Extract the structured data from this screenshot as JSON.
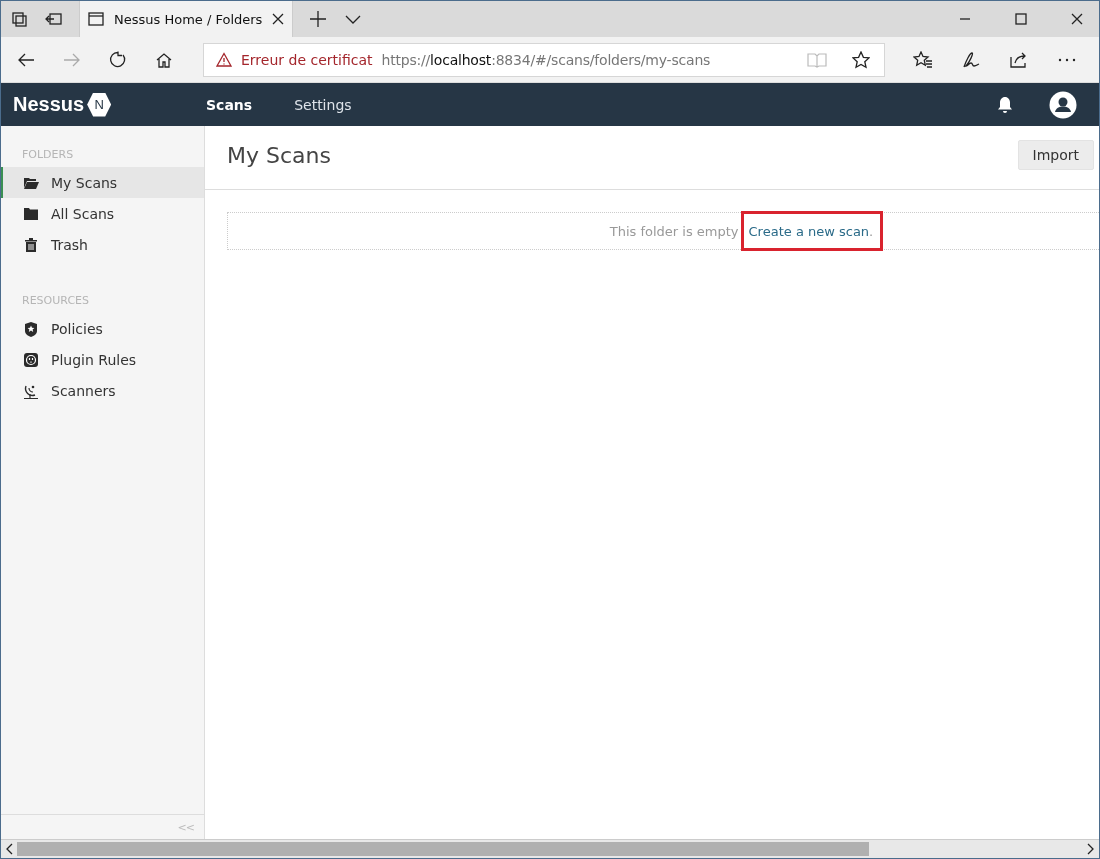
{
  "browser": {
    "tab": {
      "title": "Nessus Home / Folders"
    },
    "address": {
      "warning": "Erreur de certificat",
      "url_scheme": "https://",
      "url_host": "localhost",
      "url_rest": ":8834/#/scans/folders/my-scans"
    }
  },
  "app": {
    "logo": "Nessus",
    "logo_badge": "N",
    "nav": [
      {
        "label": "Scans",
        "selected": true
      },
      {
        "label": "Settings",
        "selected": false
      }
    ]
  },
  "sidebar": {
    "sections": [
      {
        "heading": "FOLDERS",
        "items": [
          {
            "label": "My Scans",
            "selected": true
          },
          {
            "label": "All Scans",
            "selected": false
          },
          {
            "label": "Trash",
            "selected": false
          }
        ]
      },
      {
        "heading": "RESOURCES",
        "items": [
          {
            "label": "Policies",
            "selected": false
          },
          {
            "label": "Plugin Rules",
            "selected": false
          },
          {
            "label": "Scanners",
            "selected": false
          }
        ]
      }
    ],
    "collapse": "<<"
  },
  "main": {
    "title": "My Scans",
    "import_button": "Import",
    "empty_text": "This folder is empty",
    "link": "Create a new scan",
    "link_end": "."
  }
}
